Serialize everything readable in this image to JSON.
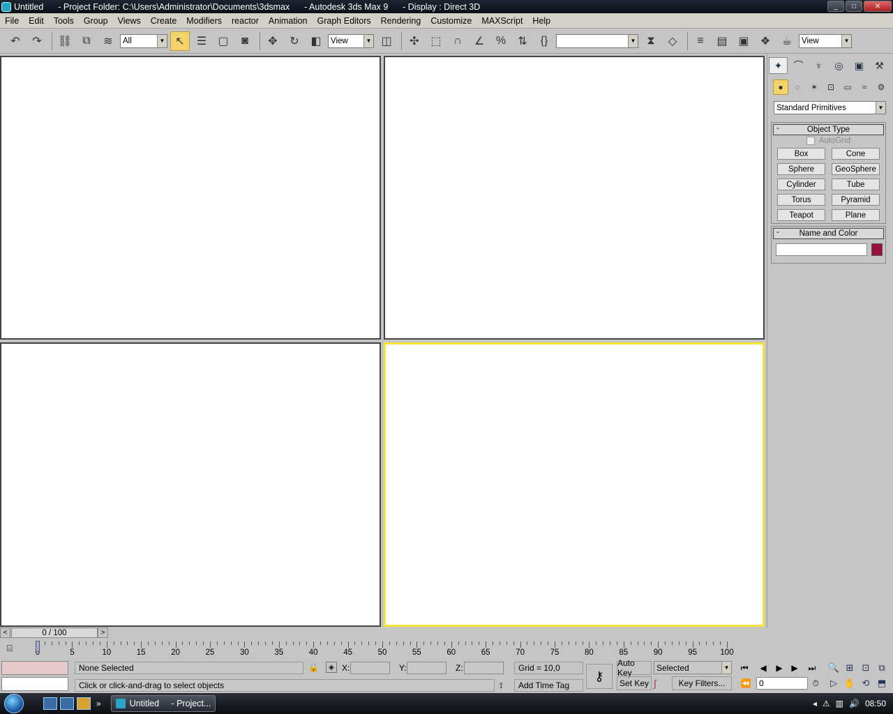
{
  "titlebar": {
    "app_title": "Untitled      - Project Folder: C:\\Users\\Administrator\\Documents\\3dsmax      - Autodesk 3ds Max 9      - Display : Direct 3D",
    "min": "_",
    "max": "□",
    "close": "✕"
  },
  "menu": [
    "File",
    "Edit",
    "Tools",
    "Group",
    "Views",
    "Create",
    "Modifiers",
    "reactor",
    "Animation",
    "Graph Editors",
    "Rendering",
    "Customize",
    "MAXScript",
    "Help"
  ],
  "toolbar": {
    "selection_filter": "All",
    "ref_coord": "View",
    "named_selection": "",
    "render_view": "View"
  },
  "command_panel": {
    "category": "Standard Primitives",
    "object_type": {
      "title": "Object Type",
      "autogrid_label": "AutoGrid",
      "buttons": [
        "Box",
        "Cone",
        "Sphere",
        "GeoSphere",
        "Cylinder",
        "Tube",
        "Torus",
        "Pyramid",
        "Teapot",
        "Plane"
      ]
    },
    "name_color": {
      "title": "Name and Color",
      "name_value": "",
      "color": "#96123c"
    },
    "rollout_toggle": "-"
  },
  "time_slider": {
    "label": "0 / 100",
    "left": "<",
    "right": ">"
  },
  "track_ticks": [
    "0",
    "5",
    "10",
    "15",
    "20",
    "25",
    "30",
    "35",
    "40",
    "45",
    "50",
    "55",
    "60",
    "65",
    "70",
    "75",
    "80",
    "85",
    "90",
    "95",
    "100"
  ],
  "status": {
    "selection": "None Selected",
    "prompt": "Click or click-and-drag to select objects",
    "x_label": "X:",
    "y_label": "Y:",
    "z_label": "Z:",
    "x_value": "",
    "y_value": "",
    "z_value": "",
    "grid": "Grid = 10,0",
    "time_tag": "Add Time Tag",
    "auto_key": "Auto Key",
    "set_key": "Set Key",
    "key_mode": "Selected",
    "key_filters": "Key Filters...",
    "current_frame": "0"
  },
  "taskbar": {
    "task_label": "Untitled     - Project...",
    "clock": "08:50",
    "more": "»"
  }
}
